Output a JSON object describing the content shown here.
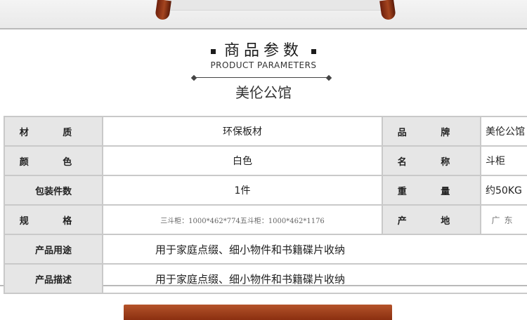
{
  "heading": {
    "title": "商品参数",
    "subtitle": "PRODUCT PARAMETERS",
    "brand": "美伦公馆"
  },
  "params": {
    "material_label": "材 质",
    "material_value": "环保板材",
    "brand_label": "品 牌",
    "brand_value": "美伦公馆",
    "color_label": "颜 色",
    "color_value": "白色",
    "name_label": "名 称",
    "name_value": "斗柜",
    "package_label": "包装件数",
    "package_value": "1件",
    "weight_label": "重 量",
    "weight_value": "约50KG",
    "spec_label": "规 格",
    "spec_value": "三斗柜：1000*462*774五斗柜：1000*462*1176",
    "origin_label": "产 地",
    "origin_value": "广东",
    "usage_label": "产品用途",
    "usage_value": "用于家庭点缀、细小物件和书籍碟片收纳",
    "desc_label": "产品描述",
    "desc_value": "用于家庭点缀、细小物件和书籍碟片收纳"
  }
}
